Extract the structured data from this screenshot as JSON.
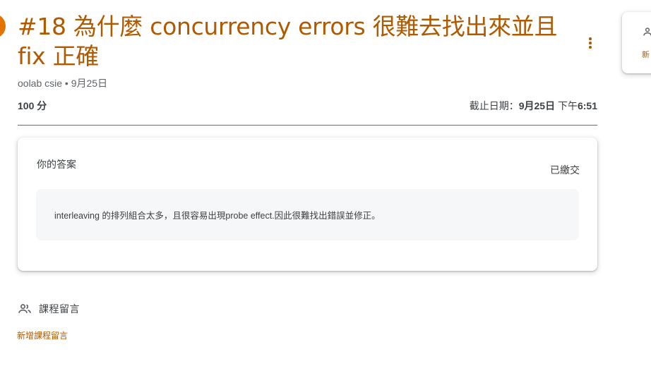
{
  "assignment": {
    "title": "#18 為什麼 concurrency errors 很難去找出來並且fix 正確",
    "meta": "oolab csie • 9月25日",
    "points": "100 分",
    "due_label": "截止日期：",
    "due_date": "9月25日",
    "due_ampm": " 下午",
    "due_time": "6:51"
  },
  "answer": {
    "heading": "你的答案",
    "status": "已繳交",
    "text": "interleaving 的排列組合太多，且很容易出現probe effect.因此很難找出錯誤並修正。"
  },
  "comments": {
    "title": "課程留言",
    "add_label": "新增課程留言"
  },
  "side_panel": {
    "link_label": "新"
  },
  "colors": {
    "accent": "#b05a00",
    "icon_orange": "#e37400",
    "divider": "#b06000"
  },
  "icons": {
    "more": "more-vert-icon",
    "people": "people-icon",
    "person": "person-icon"
  }
}
